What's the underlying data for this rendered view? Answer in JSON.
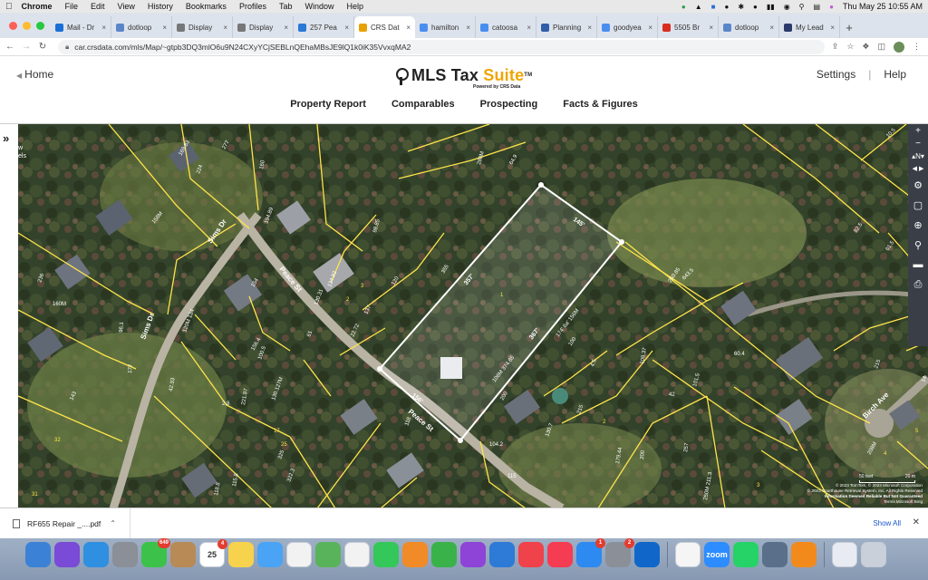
{
  "menubar": {
    "app": "Chrome",
    "items": [
      "File",
      "Edit",
      "View",
      "History",
      "Bookmarks",
      "Profiles",
      "Tab",
      "Window",
      "Help"
    ],
    "clock": "Thu May 25  10:55 AM"
  },
  "tabs": [
    {
      "label": "Mail - Dr",
      "color": "#1a6fd6"
    },
    {
      "label": "dotloop",
      "color": "#5a86c9"
    },
    {
      "label": "Display",
      "color": "#777"
    },
    {
      "label": "Display",
      "color": "#777"
    },
    {
      "label": "257 Pea",
      "color": "#2a79d6"
    },
    {
      "label": "CRS Dat",
      "color": "#e8a200",
      "active": true
    },
    {
      "label": "hamilton",
      "color": "#4a8df0"
    },
    {
      "label": "catoosa",
      "color": "#4a8df0"
    },
    {
      "label": "Planning",
      "color": "#2f5ea8"
    },
    {
      "label": "goodyea",
      "color": "#4a8df0"
    },
    {
      "label": "5505 Br",
      "color": "#d92d20"
    },
    {
      "label": "dotloop",
      "color": "#5a86c9"
    },
    {
      "label": "My Lead",
      "color": "#2a3a6a"
    }
  ],
  "address": {
    "url": "car.crsdata.com/mls/Map/~gtpb3DQ3mlO6u9N24CXyYCjSEBLnQEhaMBsJE9lQ1k0iK35VvxqMA2"
  },
  "header": {
    "home": "Home",
    "brand_main": "MLS Tax ",
    "brand_suite": "Suite",
    "brand_tm": "TM",
    "powered": "Powered by CRS Data",
    "settings": "Settings",
    "help": "Help"
  },
  "nav": [
    "Property Report",
    "Comparables",
    "Prospecting",
    "Facts & Figures"
  ],
  "map": {
    "left_label_line1": "w",
    "left_label_line2": "els",
    "streets": {
      "sims1": "Sims Dr",
      "sims2": "Sims Dr",
      "peace1": "Peace St",
      "peace2": "Peace St",
      "birch": "Birch Ave"
    },
    "selected_lot": {
      "top": "145'",
      "left": "357'",
      "right": "367'",
      "bottom": "156'",
      "inner_r": "174' 6a' 156M",
      "inner_b": "106M 374.85",
      "id": "1"
    },
    "lot_labels": [
      {
        "t": "277",
        "c": "w"
      },
      {
        "t": "169.83",
        "c": "w"
      },
      {
        "t": "224",
        "c": "w"
      },
      {
        "t": "160",
        "c": "w"
      },
      {
        "t": "194.89",
        "c": "w"
      },
      {
        "t": "158M",
        "c": "w"
      },
      {
        "t": "280M",
        "c": "w"
      },
      {
        "t": "64.9",
        "c": "w"
      },
      {
        "t": "98.85",
        "c": "w"
      },
      {
        "t": "134.82",
        "c": "w"
      },
      {
        "t": "355",
        "c": "w"
      },
      {
        "t": "120",
        "c": "w"
      },
      {
        "t": "3",
        "c": "y"
      },
      {
        "t": "2",
        "c": "y"
      },
      {
        "t": "154",
        "c": "w"
      },
      {
        "t": "130.31",
        "c": "w"
      },
      {
        "t": "137",
        "c": "w"
      },
      {
        "t": "61",
        "c": "w"
      },
      {
        "t": "22.72",
        "c": "w"
      },
      {
        "t": "120M 134",
        "c": "w"
      },
      {
        "t": "100.5",
        "c": "w"
      },
      {
        "t": "156.4",
        "c": "w"
      },
      {
        "t": "130.127M",
        "c": "w"
      },
      {
        "t": "17",
        "c": "y"
      },
      {
        "t": "221.97",
        "c": "w"
      },
      {
        "t": "2.8",
        "c": "w"
      },
      {
        "t": "42.93",
        "c": "w"
      },
      {
        "t": "96.1",
        "c": "w"
      },
      {
        "t": "177",
        "c": "w"
      },
      {
        "t": "143",
        "c": "w"
      },
      {
        "t": "236",
        "c": "w"
      },
      {
        "t": "160M",
        "c": "w"
      },
      {
        "t": "32",
        "c": "y"
      },
      {
        "t": "31",
        "c": "y"
      },
      {
        "t": "325",
        "c": "w"
      },
      {
        "t": "118.8",
        "c": "w"
      },
      {
        "t": "115.8",
        "c": "w"
      },
      {
        "t": "25",
        "c": "y"
      },
      {
        "t": "322.3",
        "c": "w"
      },
      {
        "t": "118",
        "c": "w"
      },
      {
        "t": "104.2",
        "c": "w"
      },
      {
        "t": "115",
        "c": "w"
      },
      {
        "t": "200",
        "c": "w"
      },
      {
        "t": "215",
        "c": "w"
      },
      {
        "t": "130.7",
        "c": "w"
      },
      {
        "t": "100",
        "c": "w"
      },
      {
        "t": "4.5",
        "c": "w"
      },
      {
        "t": "109.37",
        "c": "w"
      },
      {
        "t": "250.85",
        "c": "w"
      },
      {
        "t": "643.5",
        "c": "w"
      },
      {
        "t": "2",
        "c": "y"
      },
      {
        "t": "179.44",
        "c": "w"
      },
      {
        "t": "200",
        "c": "w"
      },
      {
        "t": "42",
        "c": "w"
      },
      {
        "t": "101.5",
        "c": "w"
      },
      {
        "t": "257",
        "c": "w"
      },
      {
        "t": "60.4",
        "c": "w"
      },
      {
        "t": "215",
        "c": "w"
      },
      {
        "t": "250M 211.3",
        "c": "w"
      },
      {
        "t": "3",
        "c": "y"
      },
      {
        "t": "4",
        "c": "y"
      },
      {
        "t": "208M",
        "c": "w"
      },
      {
        "t": "10.5",
        "c": "w"
      },
      {
        "t": "82.5",
        "c": "w"
      },
      {
        "t": "61.5",
        "c": "w"
      },
      {
        "t": "5",
        "c": "y"
      },
      {
        "t": "14",
        "c": "w"
      },
      {
        "t": "125.2",
        "c": "w"
      }
    ],
    "scale": {
      "left": "50 feet",
      "right": "20 m"
    },
    "attribution": [
      "© 2023 TomTom, © 2023 Microsoft Corporation",
      "© 2023 Courthouse Retrieval System, Inc. All Rights Reserved",
      "Information Deemed Reliable But Not Guaranteed",
      "Terms  Microsoft Bing"
    ]
  },
  "downloads": {
    "file": "RF655 Repair _....pdf",
    "show_all": "Show All"
  },
  "dock": [
    {
      "name": "finder",
      "color": "#3b82d6"
    },
    {
      "name": "siri",
      "color": "#7a4bd6"
    },
    {
      "name": "safari",
      "color": "#2f8fe0"
    },
    {
      "name": "launchpad",
      "color": "#8a8f98"
    },
    {
      "name": "messages",
      "color": "#3cc24a",
      "badge": "649"
    },
    {
      "name": "contacts",
      "color": "#b78a56"
    },
    {
      "name": "calendar",
      "color": "#ffffff",
      "text": "25",
      "badge": "4"
    },
    {
      "name": "notes",
      "color": "#f6d24d"
    },
    {
      "name": "mail",
      "color": "#4aa3f5"
    },
    {
      "name": "reminders",
      "color": "#f2f2f2"
    },
    {
      "name": "maps",
      "color": "#59b35a"
    },
    {
      "name": "photos",
      "color": "#f2f2f2"
    },
    {
      "name": "facetime",
      "color": "#34c759"
    },
    {
      "name": "pages",
      "color": "#f08b28"
    },
    {
      "name": "numbers",
      "color": "#39b24a"
    },
    {
      "name": "podcasts",
      "color": "#8e44d6"
    },
    {
      "name": "keynote",
      "color": "#2e7ad7"
    },
    {
      "name": "news",
      "color": "#f0424a"
    },
    {
      "name": "music",
      "color": "#f63c52"
    },
    {
      "name": "app-store",
      "color": "#2d8af0",
      "badge": "1"
    },
    {
      "name": "system-settings",
      "color": "#8a8f98",
      "badge": "2"
    },
    {
      "name": "outlook",
      "color": "#1067c9"
    },
    {
      "name": "chrome",
      "color": "#f5f5f5"
    },
    {
      "name": "zoom",
      "color": "#2d8cff",
      "text": "zoom"
    },
    {
      "name": "whatsapp",
      "color": "#25d366"
    },
    {
      "name": "preview",
      "color": "#5a6f8a"
    },
    {
      "name": "firefox",
      "color": "#f28a1b"
    },
    {
      "name": "documents",
      "color": "#e8ecf2"
    },
    {
      "name": "trash",
      "color": "#c9d0da"
    }
  ],
  "colors": {
    "brand_accent": "#f0a500",
    "lot_lines": "#ffe44a",
    "selected_outline": "#ffffff",
    "map_bg": "#2f3d24"
  }
}
